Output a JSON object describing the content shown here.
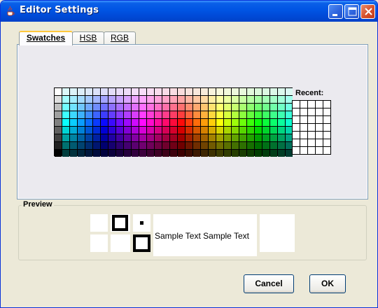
{
  "window": {
    "title": "Editor Settings"
  },
  "tabs": [
    {
      "label": "Swatches",
      "mnemonic": "S",
      "active": true
    },
    {
      "label": "HSB",
      "mnemonic": "H",
      "active": false
    },
    {
      "label": "RGB",
      "mnemonic": "G",
      "active": false
    }
  ],
  "swatches": {
    "recent_label": "Recent:"
  },
  "preview": {
    "title": "Preview",
    "sample_text_light": "Sample Text  Sample Text",
    "sample_text_dark": "Sample Text  Sample Text"
  },
  "buttons": {
    "cancel": "Cancel",
    "ok": "OK"
  },
  "colors": {
    "titlebar": "#0054e3",
    "panel_border": "#7f9db9",
    "active_tab_accent": "#ffc83c",
    "close_button": "#d6502a"
  },
  "icons": {
    "app": "java-cup-icon",
    "minimize": "minimize-icon",
    "maximize": "maximize-icon",
    "close": "close-icon"
  }
}
